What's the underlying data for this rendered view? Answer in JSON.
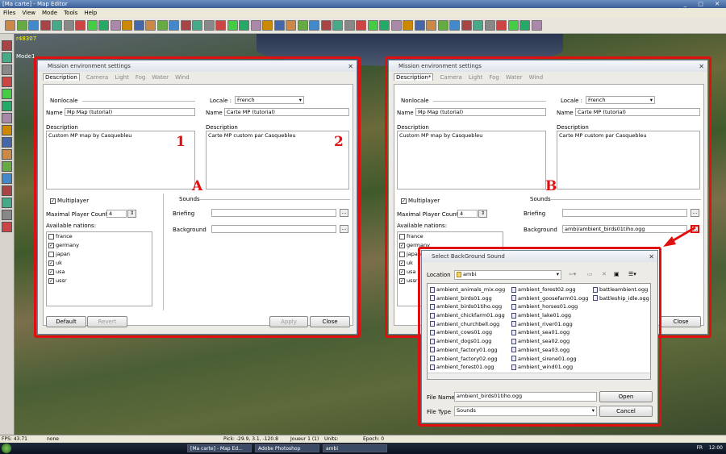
{
  "window": {
    "title": "[Ma carte] - Map Editor"
  },
  "menu": [
    "Files",
    "View",
    "Mode",
    "Tools",
    "Help"
  ],
  "viewport": {
    "coord": "r48307",
    "mode": "Mode1"
  },
  "dialog1": {
    "title": "Mission environment settings",
    "tabs": [
      "Description",
      "Camera",
      "Light",
      "Fog",
      "Water",
      "Wind"
    ],
    "nonlocale": "Nonlocale",
    "locale_label": "Locale :",
    "locale_value": "French",
    "name_label": "Name",
    "name_value": "Mp Map (tutorial)",
    "name_value_locale": "Carte MP (tutorial)",
    "desc_label": "Description",
    "desc_value": "Custom MP map by Casquebleu",
    "desc_value_locale": "Carte MP custom par Casquebleu",
    "multiplayer_label": "Multiplayer",
    "max_players_label": "Maximal Player Count",
    "max_players_value": "4",
    "nations_label": "Available nations:",
    "nations": [
      {
        "name": "france",
        "checked": false
      },
      {
        "name": "germany",
        "checked": true
      },
      {
        "name": "japan",
        "checked": false
      },
      {
        "name": "uk",
        "checked": true
      },
      {
        "name": "usa",
        "checked": true
      },
      {
        "name": "ussr",
        "checked": true
      }
    ],
    "sounds_label": "Sounds",
    "briefing_label": "Briefing",
    "background_label": "Background",
    "background_value": "",
    "buttons": {
      "default": "Default",
      "revert": "Revert",
      "apply": "Apply",
      "close": "Close"
    }
  },
  "dialog2": {
    "title": "Mission environment settings",
    "tabs": [
      "Description*",
      "Camera",
      "Light",
      "Fog",
      "Water",
      "Wind"
    ],
    "background_value": "ambi/ambient_birds01tiho.ogg",
    "close": "Close"
  },
  "annotations": {
    "one": "1",
    "two": "2",
    "a": "A",
    "b": "B"
  },
  "file_dialog": {
    "title": "Select BackGround Sound",
    "location_label": "Location",
    "location_value": "ambi",
    "files_col1": [
      "ambient_animals_mix.ogg",
      "ambient_birds01.ogg",
      "ambient_birds01tiho.ogg",
      "ambient_chickfarm01.ogg",
      "ambient_churchbell.ogg",
      "ambient_cows01.ogg",
      "ambient_dogs01.ogg",
      "ambient_factory01.ogg",
      "ambient_factory02.ogg",
      "ambient_forest01.ogg"
    ],
    "files_col2": [
      "ambient_forest02.ogg",
      "ambient_goosefarm01.ogg",
      "ambient_horses01.ogg",
      "ambient_lake01.ogg",
      "ambient_river01.ogg",
      "ambient_sea01.ogg",
      "ambient_sea02.ogg",
      "ambient_sea03.ogg",
      "ambient_sirene01.ogg",
      "ambient_wind01.ogg"
    ],
    "files_col3": [
      "battleambient.ogg",
      "battleship_idle.ogg"
    ],
    "filename_label": "File Name",
    "filename_value": "ambient_birds01tiho.ogg",
    "filetype_label": "File Type",
    "filetype_value": "Sounds",
    "open": "Open",
    "cancel": "Cancel"
  },
  "status": {
    "fps": "FPS: 43.71",
    "sel": "none",
    "pick": "Pick: -29.9, 3.1, -120.8",
    "player": "Joueur 1 (1)",
    "units": "Units:",
    "epoch": "Epoch: 0"
  },
  "taskbar": {
    "items": [
      "[Ma carte] - Map Ed...",
      "Adobe Photoshop",
      "ambi"
    ],
    "lang": "FR",
    "time": "12:00"
  }
}
